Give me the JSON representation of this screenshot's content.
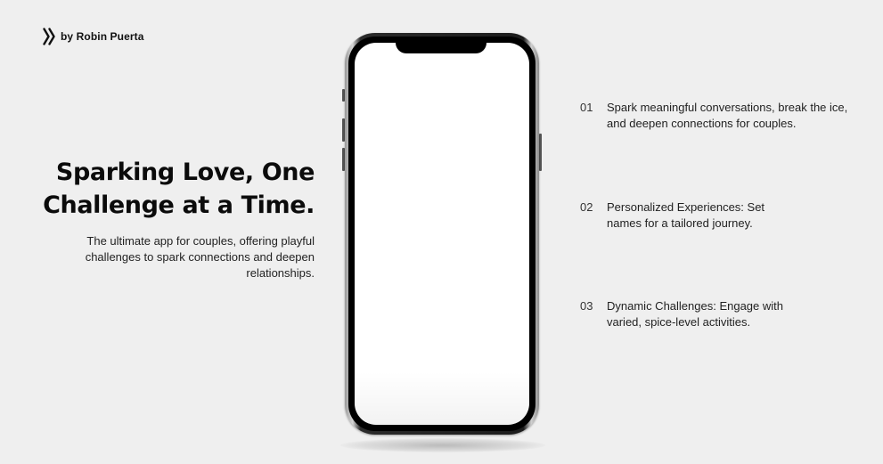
{
  "brand": {
    "icon": "double-chevron-right-icon",
    "byline": "by Robin Puerta"
  },
  "hero": {
    "title_line1": "Sparking Love, One",
    "title_line2": "Challenge at a Time.",
    "subtitle": "The ultimate app for couples, offering playful challenges to spark connections and deepen relationships."
  },
  "features": [
    {
      "number": "01",
      "text": "Spark meaningful conversations, break the ice, and deepen connections for couples."
    },
    {
      "number": "02",
      "text": "Personalized Experiences: Set names for a tailored journey."
    },
    {
      "number": "03",
      "text": "Dynamic Challenges: Engage with varied, spice-level activities."
    }
  ],
  "colors": {
    "background": "#efefef",
    "text": "#111111",
    "phone_frame": "#1c1c1c",
    "screen": "#ffffff"
  }
}
